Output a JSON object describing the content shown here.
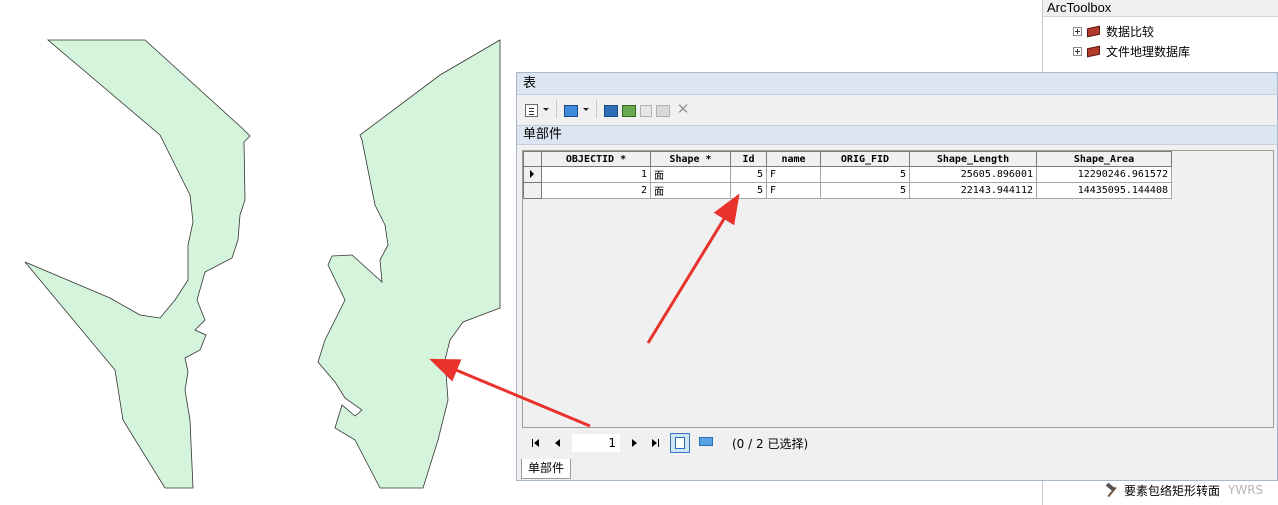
{
  "toolbox": {
    "title": "ArcToolbox",
    "items": [
      {
        "label": "数据比较",
        "icon": "toolbox-icon"
      },
      {
        "label": "文件地理数据库",
        "icon": "toolbox-icon"
      }
    ],
    "bottom_item": {
      "label": "要素包络矩形转面",
      "icon": "hammer-icon"
    },
    "watermark": "YWRS"
  },
  "table_window": {
    "title": "表",
    "layer_tab": "单部件",
    "bottom_tab": "单部件",
    "toolbar_icons": [
      "table-options-icon",
      "select-by-attributes-icon",
      "related-tables-icon",
      "switch-selection-icon",
      "clear-selection-icon",
      "zoom-to-selected-icon",
      "delete-selected-icon"
    ],
    "columns": [
      "OBJECTID *",
      "Shape *",
      "Id",
      "name",
      "ORIG_FID",
      "Shape_Length",
      "Shape_Area"
    ],
    "rows": [
      {
        "objectid": "1",
        "shape": "面",
        "id": "5",
        "name": "F",
        "orig_fid": "5",
        "shape_length": "25605.896001",
        "shape_area": "12290246.961572",
        "current": true
      },
      {
        "objectid": "2",
        "shape": "面",
        "id": "5",
        "name": "F",
        "orig_fid": "5",
        "shape_length": "22143.944112",
        "shape_area": "14435095.144408",
        "current": false
      }
    ],
    "navigation": {
      "current_record": "1",
      "selection_status": "(0 / 2 已选择)"
    }
  },
  "map": {
    "polygon_fill": "#d4f5dc",
    "polygon_stroke": "#333333",
    "arrow_color": "#e8322b"
  }
}
